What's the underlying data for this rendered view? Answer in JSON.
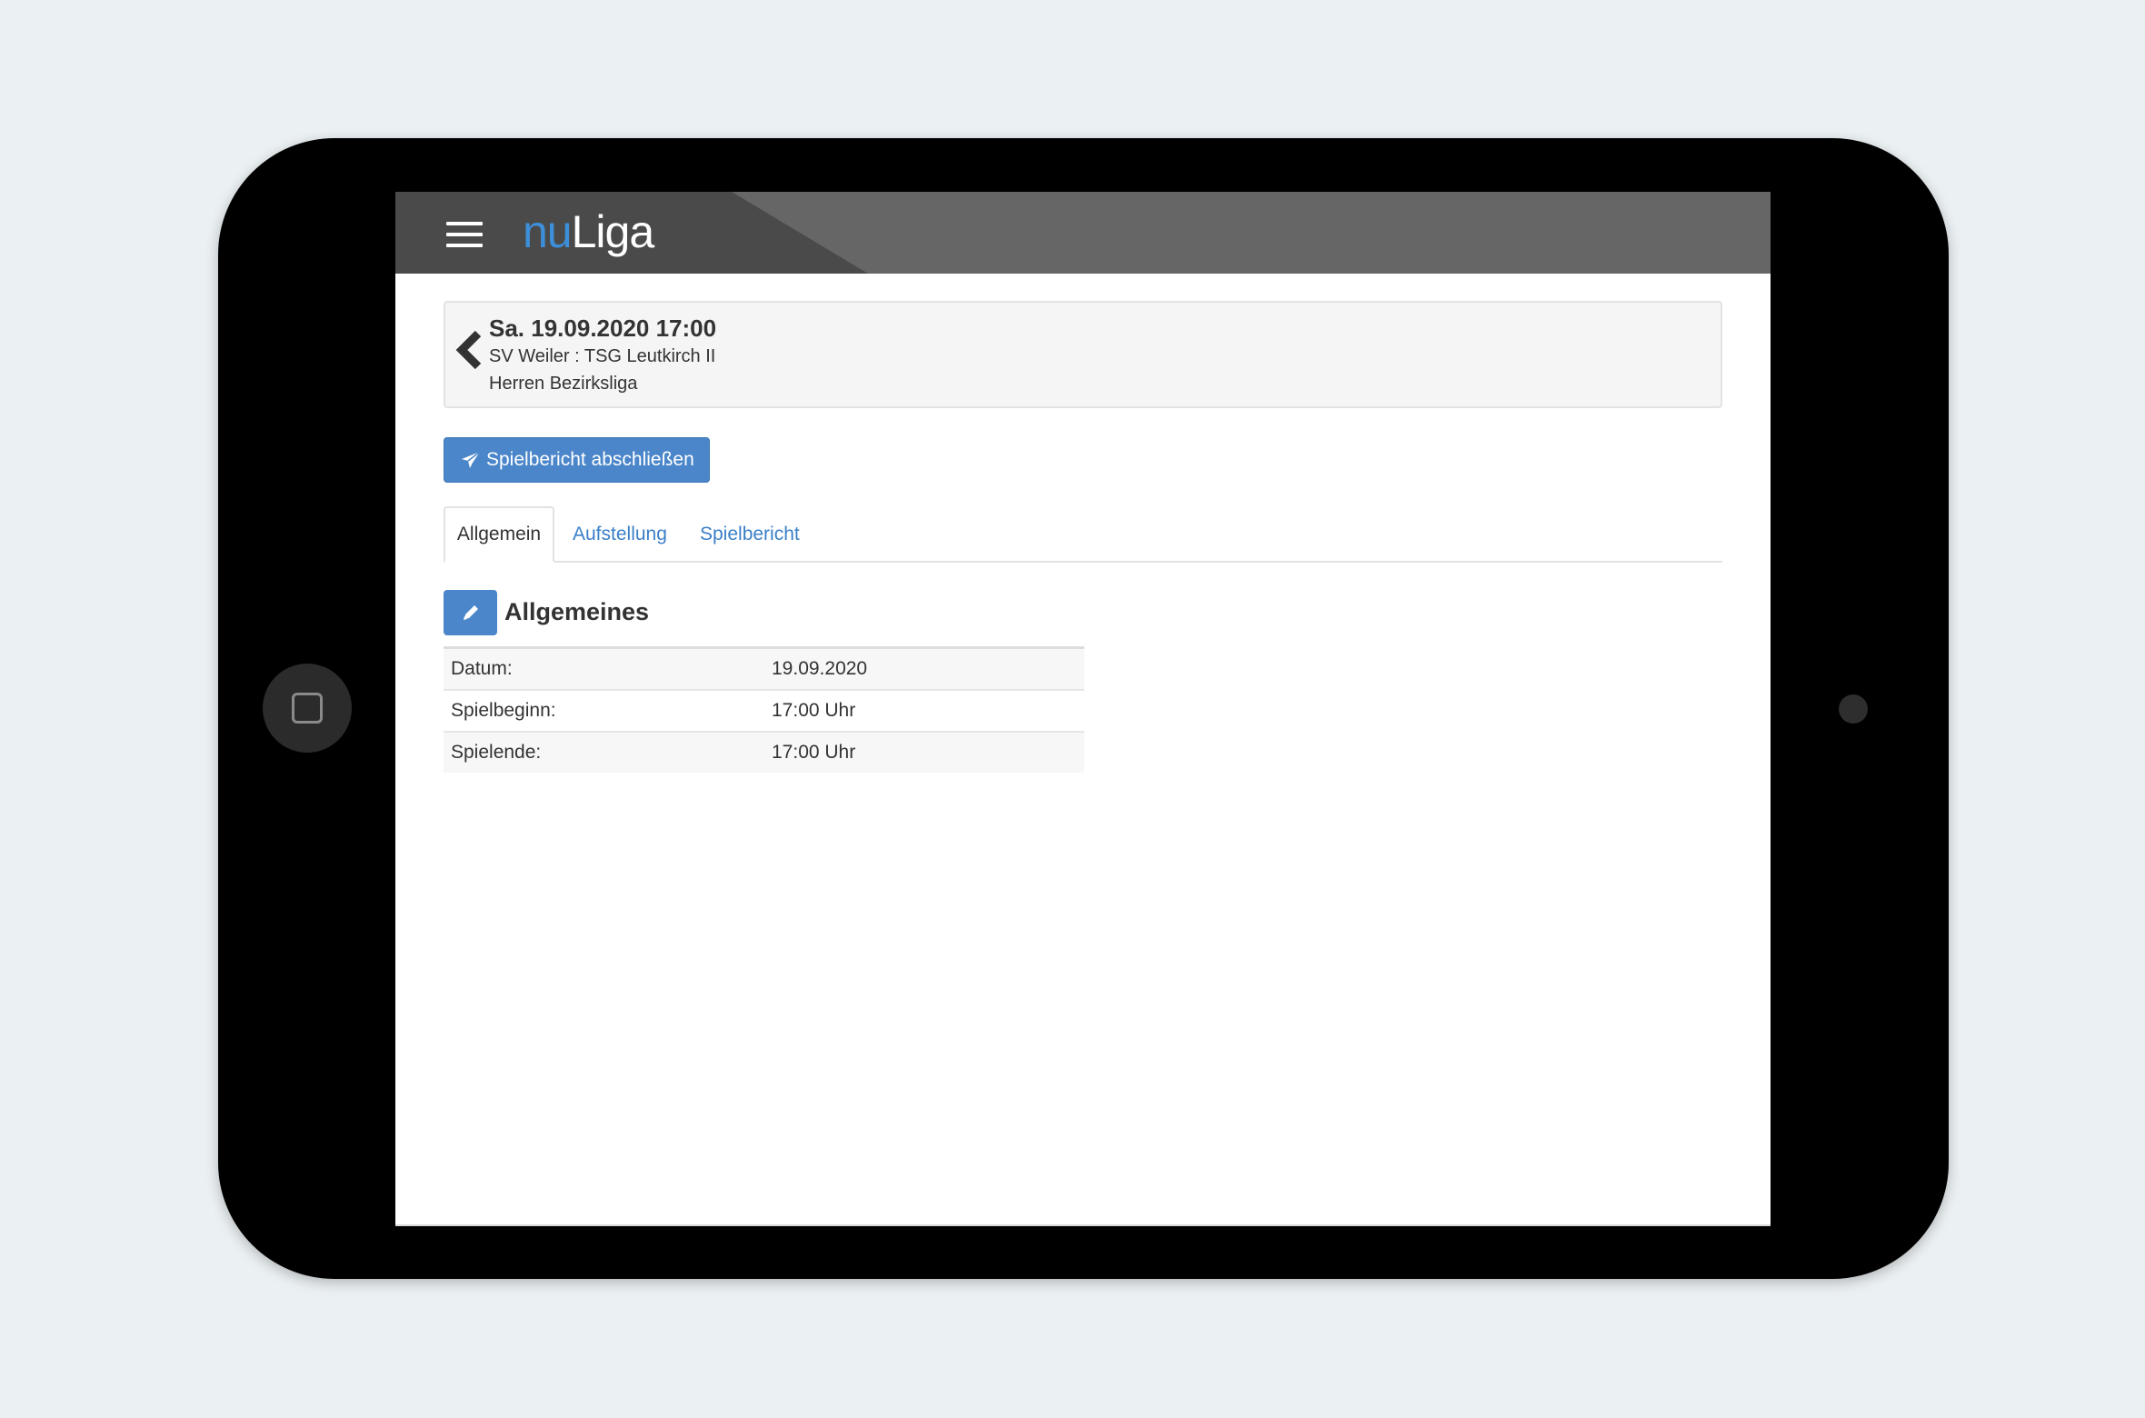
{
  "app": {
    "logo_nu": "nu",
    "logo_liga": "Liga"
  },
  "match": {
    "title": "Sa. 19.09.2020 17:00",
    "teams": "SV Weiler : TSG Leutkirch II",
    "league": "Herren Bezirksliga"
  },
  "actions": {
    "submit_label": "Spielbericht abschließen"
  },
  "tabs": [
    {
      "label": "Allgemein",
      "active": true
    },
    {
      "label": "Aufstellung",
      "active": false
    },
    {
      "label": "Spielbericht",
      "active": false
    }
  ],
  "section": {
    "title": "Allgemeines"
  },
  "details": [
    {
      "label": "Datum:",
      "value": "19.09.2020"
    },
    {
      "label": "Spielbeginn:",
      "value": "17:00 Uhr"
    },
    {
      "label": "Spielende:",
      "value": "17:00 Uhr"
    }
  ],
  "colors": {
    "accent": "#4a86c9",
    "link": "#3a7fc8",
    "logo_blue": "#3d8fd9",
    "header": "#666666"
  },
  "icons": {
    "menu": "hamburger-menu-icon",
    "back": "chevron-left-icon",
    "submit": "paper-plane-icon",
    "edit": "pencil-icon"
  }
}
